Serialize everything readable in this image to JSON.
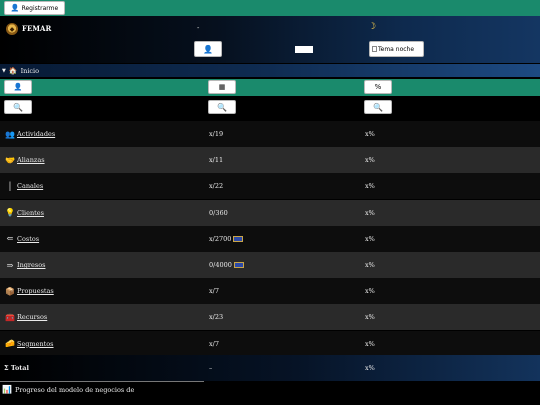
{
  "topbar": {
    "register_label": "Registrarme",
    "register_icon": "user-icon"
  },
  "header": {
    "brand": "FEMAR",
    "dash": "-",
    "moon_icon": "moon-icon",
    "user_button_icon": "user-icon",
    "theme_alt": "Tema noche"
  },
  "nav": {
    "inicio_label": "Inicio"
  },
  "table": {
    "header_buttons": [
      {
        "icon": "user-icon"
      },
      {
        "icon": "calendar-icon"
      },
      {
        "icon": "percent-icon",
        "label": "%"
      }
    ],
    "rows": [
      {
        "icon": "people-icon",
        "glyph": "👥",
        "label": "Actividades",
        "count": "x/19",
        "pct": "x%",
        "flag": false
      },
      {
        "icon": "handshake-icon",
        "glyph": "🤝",
        "label": "Alianzas",
        "count": "x/11",
        "pct": "x%",
        "flag": false
      },
      {
        "icon": "channel-icon",
        "glyph": "│",
        "label": "Canales",
        "count": "x/22",
        "pct": "x%",
        "flag": false
      },
      {
        "icon": "client-icon",
        "glyph": "💡",
        "label": "Clientes",
        "count": "0/360",
        "pct": "x%",
        "flag": false
      },
      {
        "icon": "costs-icon",
        "glyph": "⇐",
        "label": "Costos",
        "count": "x/2700",
        "pct": "x%",
        "flag": true
      },
      {
        "icon": "income-icon",
        "glyph": "⇒",
        "label": "Ingresos",
        "count": "0/4000",
        "pct": "x%",
        "flag": true
      },
      {
        "icon": "package-icon",
        "glyph": "📦",
        "label": "Propuestas",
        "count": "x/7",
        "pct": "x%",
        "flag": false
      },
      {
        "icon": "resources-icon",
        "glyph": "🧰",
        "label": "Recursos",
        "count": "x/23",
        "pct": "x%",
        "flag": false
      },
      {
        "icon": "segments-icon",
        "glyph": "🧀",
        "label": "Segmentos",
        "count": "x/7",
        "pct": "x%",
        "flag": false
      }
    ],
    "total": {
      "icon": "sigma-icon",
      "label": "Σ Total",
      "count": "–",
      "pct": "x%"
    }
  },
  "footer": {
    "icon": "chart-icon",
    "text": "Progreso del modelo de negocios de"
  },
  "colors": {
    "teal": "#1a8a6c",
    "navy": "#143662"
  }
}
